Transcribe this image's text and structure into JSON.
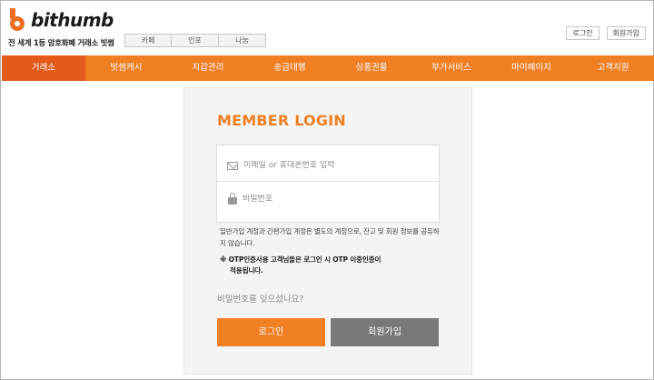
{
  "brand": {
    "name": "bithumb",
    "tagline": "전 세계 1등 암호화폐 거래소 빗썸",
    "accent": "#f07f24",
    "accent_dark": "#e25a1c"
  },
  "sub_tabs": [
    {
      "label": "카페"
    },
    {
      "label": "인포"
    },
    {
      "label": "나눔"
    }
  ],
  "top_actions": {
    "login": "로그인",
    "signup": "회원가입"
  },
  "nav": {
    "items": [
      {
        "label": "거래소",
        "active": true
      },
      {
        "label": "빗썸캐시"
      },
      {
        "label": "지갑관리"
      },
      {
        "label": "송금대행"
      },
      {
        "label": "상품권몰"
      },
      {
        "label": "부가서비스"
      },
      {
        "label": "마이페이지"
      },
      {
        "label": "고객지원"
      }
    ]
  },
  "login": {
    "title": "MEMBER LOGIN",
    "email_placeholder": "이메일 or 휴대폰번호 입력",
    "password_placeholder": "비밀번호",
    "notice": "일반가입 계정과 간편가입 계정은 별도의 계정으로, 잔고 및 회원 정보를 공유하지 않습니다.",
    "otp_line1": "※ OTP인증사용 고객님들은 로그인 시 OTP 이중인증이",
    "otp_line2": "적용됩니다.",
    "forgot": "비밀번호를 잊으셨나요?",
    "login_button": "로그인",
    "signup_button": "회원가입",
    "login_color": "#f07f24",
    "signup_color": "#797979"
  },
  "icons": {
    "logo": "bithumb-logo-icon",
    "email": "mail-icon",
    "password": "lock-icon"
  }
}
